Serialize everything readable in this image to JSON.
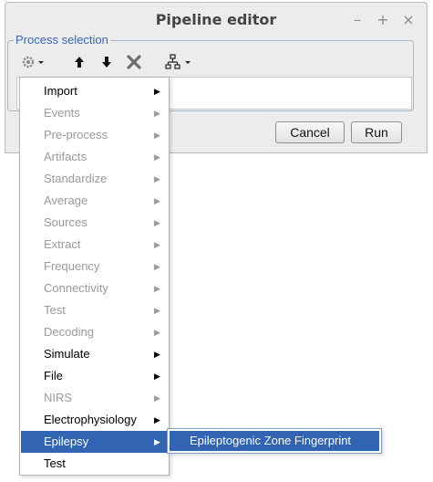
{
  "window": {
    "title": "Pipeline editor",
    "controls": {
      "minimize": "–",
      "maximize": "+",
      "close": "×"
    }
  },
  "process_selection": {
    "label": "Process selection"
  },
  "toolbar": {
    "icons": [
      "gear-icon",
      "arrow-up-icon",
      "arrow-down-icon",
      "delete-icon",
      "tree-icon"
    ]
  },
  "buttons": {
    "cancel": "Cancel",
    "run": "Run"
  },
  "menu": {
    "items": [
      {
        "label": "Import",
        "state": "enabled",
        "arrow": "▶"
      },
      {
        "label": "Events",
        "state": "disabled",
        "arrow": "▶"
      },
      {
        "label": "Pre-process",
        "state": "disabled",
        "arrow": "▶"
      },
      {
        "label": "Artifacts",
        "state": "disabled",
        "arrow": "▶"
      },
      {
        "label": "Standardize",
        "state": "disabled",
        "arrow": "▶"
      },
      {
        "label": "Average",
        "state": "disabled",
        "arrow": "▶"
      },
      {
        "label": "Sources",
        "state": "disabled",
        "arrow": "▶"
      },
      {
        "label": "Extract",
        "state": "disabled",
        "arrow": "▶"
      },
      {
        "label": "Frequency",
        "state": "disabled",
        "arrow": "▶"
      },
      {
        "label": "Connectivity",
        "state": "disabled",
        "arrow": "▶"
      },
      {
        "label": "Test",
        "state": "disabled",
        "arrow": "▶"
      },
      {
        "label": "Decoding",
        "state": "disabled",
        "arrow": "▶"
      },
      {
        "label": "Simulate",
        "state": "enabled",
        "arrow": "▶"
      },
      {
        "label": "File",
        "state": "enabled",
        "arrow": "▶"
      },
      {
        "label": "NIRS",
        "state": "disabled",
        "arrow": "▶"
      },
      {
        "label": "Electrophysiology",
        "state": "enabled",
        "arrow": "▶"
      },
      {
        "label": "Epilepsy",
        "state": "selected",
        "arrow": "▶"
      },
      {
        "label": "Test",
        "state": "enabled",
        "arrow": ""
      }
    ]
  },
  "submenu": {
    "items": [
      {
        "label": "Epileptogenic Zone Fingerprint"
      }
    ]
  },
  "colors": {
    "accent": "#3165b3",
    "group_label": "#3b67b8",
    "disabled_text": "#9a9a9a"
  }
}
